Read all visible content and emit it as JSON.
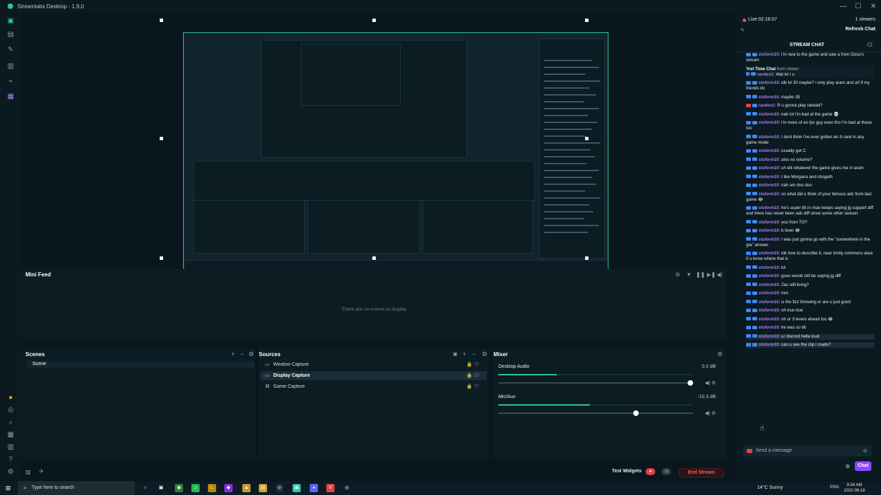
{
  "titlebar": {
    "title": "Streamlabs Desktop - 1.9.0",
    "minimize": "—",
    "maximize": "☐",
    "close": "✕"
  },
  "minifeed": {
    "title": "Mini Feed",
    "empty_text": "There are no events to display"
  },
  "scenes": {
    "title": "Scenes",
    "items": [
      "Scene"
    ]
  },
  "sources": {
    "title": "Sources",
    "items": [
      {
        "name": "Window Capture",
        "icon": "window-icon"
      },
      {
        "name": "Display Capture",
        "icon": "monitor-icon",
        "active": true
      },
      {
        "name": "Game Capture",
        "icon": "gamepad-icon"
      }
    ]
  },
  "mixer": {
    "title": "Mixer",
    "channels": [
      {
        "name": "Desktop Audio",
        "db": "0.0 dB",
        "meter_level": 0.3,
        "volume": 1.0
      },
      {
        "name": "Mic/Aux",
        "db": "-10.3 dB",
        "meter_level": 0.47,
        "volume": 0.72
      }
    ]
  },
  "footer": {
    "test_widgets": "Test Widgets",
    "end_stream": "End Stream"
  },
  "live": {
    "time": "Live 02:16:07",
    "viewers": "1 viewers",
    "refresh": "Refresh Chat"
  },
  "chat": {
    "title": "STREAM CHAT",
    "placeholder": "Send a message",
    "button": "Chat",
    "messages": [
      {
        "user": "stsform10",
        "text": "i'm new to the game and saw a from Gosu's stream"
      },
      {
        "first": true,
        "header": "First Time Chat",
        "from": "from viewer",
        "user": "randex1",
        "text": "Wat lvl r u"
      },
      {
        "user": "stsform10",
        "text": "idk lvl 30 maybe? i only play aram and urf if my friends do"
      },
      {
        "user": "stsform10",
        "text": "maybe 35"
      },
      {
        "user": "randex1",
        "text": "R u gonna play ranked?",
        "red": true
      },
      {
        "user": "stsform10",
        "text": "nah lol I'm bad at the game 💀"
      },
      {
        "user": "stsform10",
        "text": "i'm more of an fps guy even tho I'm bad at those too"
      },
      {
        "user": "stsform10",
        "text": "I dont think I've ever gotten an S rank in any game mode"
      },
      {
        "user": "stsform10",
        "text": "usually get C"
      },
      {
        "user": "stsform10",
        "text": "also no volume?"
      },
      {
        "user": "stsform10",
        "text": "uh idk whatever the game gives me in aram"
      },
      {
        "user": "stsform10",
        "text": "I like Morgana and chogath"
      },
      {
        "user": "stsform10",
        "text": "nah am doo doo"
      },
      {
        "user": "stsform10",
        "text": "so what did u think of your famous adc from last game 😂"
      },
      {
        "user": "stsform10",
        "text": "he's super tilt rn man keeps saying jg support diff and there has never been adc diff since some other season"
      },
      {
        "user": "stsform10",
        "text": "you from TO?"
      },
      {
        "user": "stsform10",
        "text": "b town 😂"
      },
      {
        "user": "stsform10",
        "text": "I was just gonna go with the \"somewhere in the gta\" answer"
      },
      {
        "user": "stsform10",
        "text": "idk how to describe it, near trinity commons area if u know where that is"
      },
      {
        "user": "stsform10",
        "text": "lol"
      },
      {
        "user": "stsform10",
        "text": "gosu would still be saying jg diff"
      },
      {
        "user": "stsform10",
        "text": "Zac still living?"
      },
      {
        "user": "stsform10",
        "text": "mm"
      },
      {
        "user": "stsform10",
        "text": "is the fizz throwing or are u just good"
      },
      {
        "user": "stsform10",
        "text": "oh true true"
      },
      {
        "user": "stsform10",
        "text": "oh ur 3 levels ahead too 😂"
      },
      {
        "user": "stsform10",
        "text": "he was so tilt"
      },
      {
        "user": "stsform10",
        "text": "ur discord hella loud",
        "hl": true
      },
      {
        "user": "stsform10",
        "text": "can u see the clip I made?",
        "hl": true
      }
    ]
  },
  "taskbar": {
    "search_placeholder": "Type here to search",
    "weather": "14°C  Sunny",
    "lang": "ENG",
    "time": "9:34 AM",
    "date": "2022-06-18"
  },
  "colors": {
    "accent": "#31c3a2",
    "live": "#ff4f4f",
    "chat_button": "#9146ff",
    "username": "#b07cff"
  }
}
